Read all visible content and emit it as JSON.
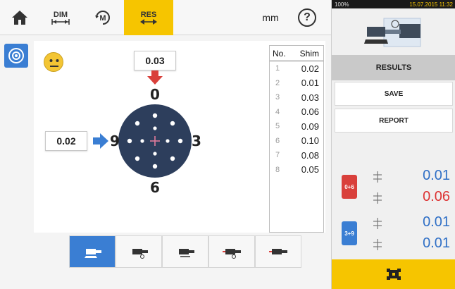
{
  "toolbar": {
    "dim_label": "DIM",
    "res_label": "RES",
    "unit": "mm",
    "help": "?"
  },
  "status": {
    "battery": "100%",
    "time": "15.07.2015 11:32"
  },
  "diagram": {
    "top_value": "0.03",
    "left_value": "0.02",
    "label_0": "0",
    "label_3": "3",
    "label_6": "6",
    "label_9": "9"
  },
  "shim_table": {
    "col_no": "No.",
    "col_shim": "Shim",
    "rows": [
      {
        "no": "1",
        "shim": "0.02"
      },
      {
        "no": "2",
        "shim": "0.01"
      },
      {
        "no": "3",
        "shim": "0.03"
      },
      {
        "no": "4",
        "shim": "0.06"
      },
      {
        "no": "5",
        "shim": "0.09"
      },
      {
        "no": "6",
        "shim": "0.10"
      },
      {
        "no": "7",
        "shim": "0.08"
      },
      {
        "no": "8",
        "shim": "0.05"
      }
    ]
  },
  "results": {
    "header": "RESULTS",
    "save": "SAVE",
    "report": "REPORT",
    "vertical_tag": "0+6",
    "horizontal_tag": "3+9",
    "v_offset": "0.01",
    "v_angle": "0.06",
    "h_offset": "0.01",
    "h_angle": "0.01"
  },
  "colors": {
    "accent_yellow": "#f6c500",
    "accent_blue": "#3a7ed3",
    "bad_red": "#d33333"
  }
}
